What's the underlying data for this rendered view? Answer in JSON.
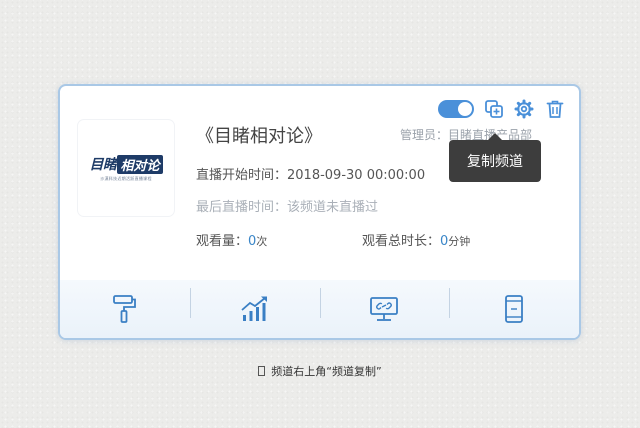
{
  "channel": {
    "logo": {
      "main_a": "目睹",
      "main_b": "相对论",
      "sub": "沙漠科技近期活跃直播课程"
    },
    "title": "《目睹相对论》",
    "admin": "管理员：目睹直播产品部",
    "start_time_label": "直播开始时间：",
    "start_time_value": "2018-09-30 00:00:00",
    "last_live_text": "最后直播时间：该频道未直播过",
    "views_label": "观看量：",
    "views_value": "0",
    "views_unit": "次",
    "watch_time_label": "观看总时长：",
    "watch_time_value": "0",
    "watch_time_unit": "分钟"
  },
  "toolbar": {
    "toggle_on": true,
    "tooltip": "复制频道",
    "icons": [
      "copy-icon",
      "gear-icon",
      "trash-icon"
    ]
  },
  "bottom_icons": [
    "paint-roller-icon",
    "growth-chart-icon",
    "monitor-icon",
    "mobile-icon"
  ],
  "caption": "频道右上角“频道复制”",
  "colors": {
    "accent": "#4a90d9",
    "border": "#a9c8e6",
    "tooltip_bg": "#3d3d3d"
  }
}
